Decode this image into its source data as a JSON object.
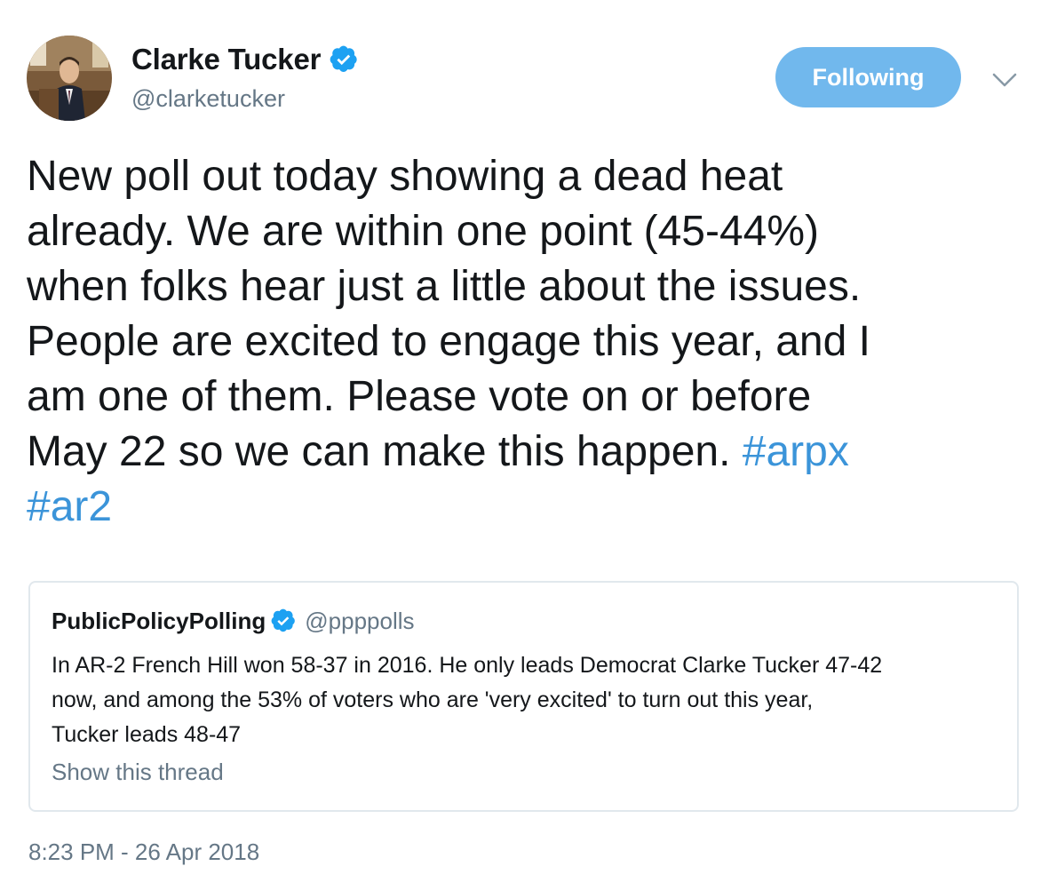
{
  "author": {
    "display_name": "Clarke Tucker",
    "handle": "@clarketucker",
    "verified_icon": "verified-badge-icon",
    "avatar_icon": "profile-photo"
  },
  "follow_button": {
    "label": "Following"
  },
  "menu_caret": {
    "icon": "chevron-down-icon"
  },
  "tweet": {
    "text": "New poll out today showing a dead heat\nalready. We are within one point (45-44%)\nwhen folks hear just a little about the issues.\nPeople are excited to engage this year, and I\nam one of them. Please vote on or before\nMay 22 so we can make this happen. ",
    "hashtags": [
      "#arpx",
      "#ar2"
    ],
    "timestamp": "8:23 PM - 26 Apr 2018"
  },
  "quoted_tweet": {
    "display_name": "PublicPolicyPolling",
    "handle": "@ppppolls",
    "text": "In AR-2 French Hill won 58-37 in 2016. He only leads Democrat Clarke Tucker 47-42\nnow, and among the 53% of voters who are 'very excited' to turn out this year,\nTucker leads 48-47",
    "show_thread_label": "Show this thread"
  },
  "colors": {
    "text": "#14171a",
    "secondary": "#657786",
    "link": "#3b94d9",
    "follow_button_bg": "#71b8ed",
    "verified": "#1da1f2",
    "border": "#e1e8ed"
  }
}
